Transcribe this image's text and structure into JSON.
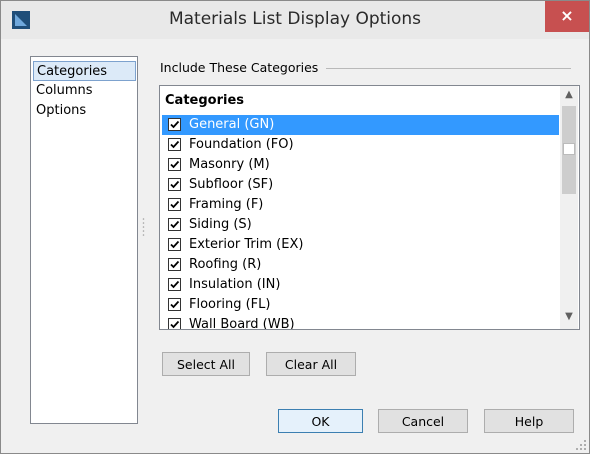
{
  "window": {
    "title": "Materials List Display Options",
    "close_label": "×"
  },
  "nav": {
    "items": [
      "Categories",
      "Columns",
      "Options"
    ],
    "selected": "Categories"
  },
  "group": {
    "label": "Include These Categories"
  },
  "list": {
    "header": "Categories",
    "rows": [
      {
        "label": "General (GN)",
        "checked": true,
        "selected": true
      },
      {
        "label": "Foundation (FO)",
        "checked": true
      },
      {
        "label": "Masonry (M)",
        "checked": true
      },
      {
        "label": "Subfloor (SF)",
        "checked": true
      },
      {
        "label": "Framing (F)",
        "checked": true
      },
      {
        "label": "Siding (S)",
        "checked": true
      },
      {
        "label": "Exterior Trim (EX)",
        "checked": true
      },
      {
        "label": "Roofing (R)",
        "checked": true
      },
      {
        "label": "Insulation (IN)",
        "checked": true
      },
      {
        "label": "Flooring (FL)",
        "checked": true
      },
      {
        "label": "Wall Board (WB)",
        "checked": true
      }
    ]
  },
  "buttons": {
    "select_all": "Select All",
    "clear_all": "Clear All",
    "ok": "OK",
    "cancel": "Cancel",
    "help": "Help"
  },
  "colors": {
    "selection": "#3399ff",
    "close": "#c75050",
    "nav_selection": "#dceaf8"
  }
}
